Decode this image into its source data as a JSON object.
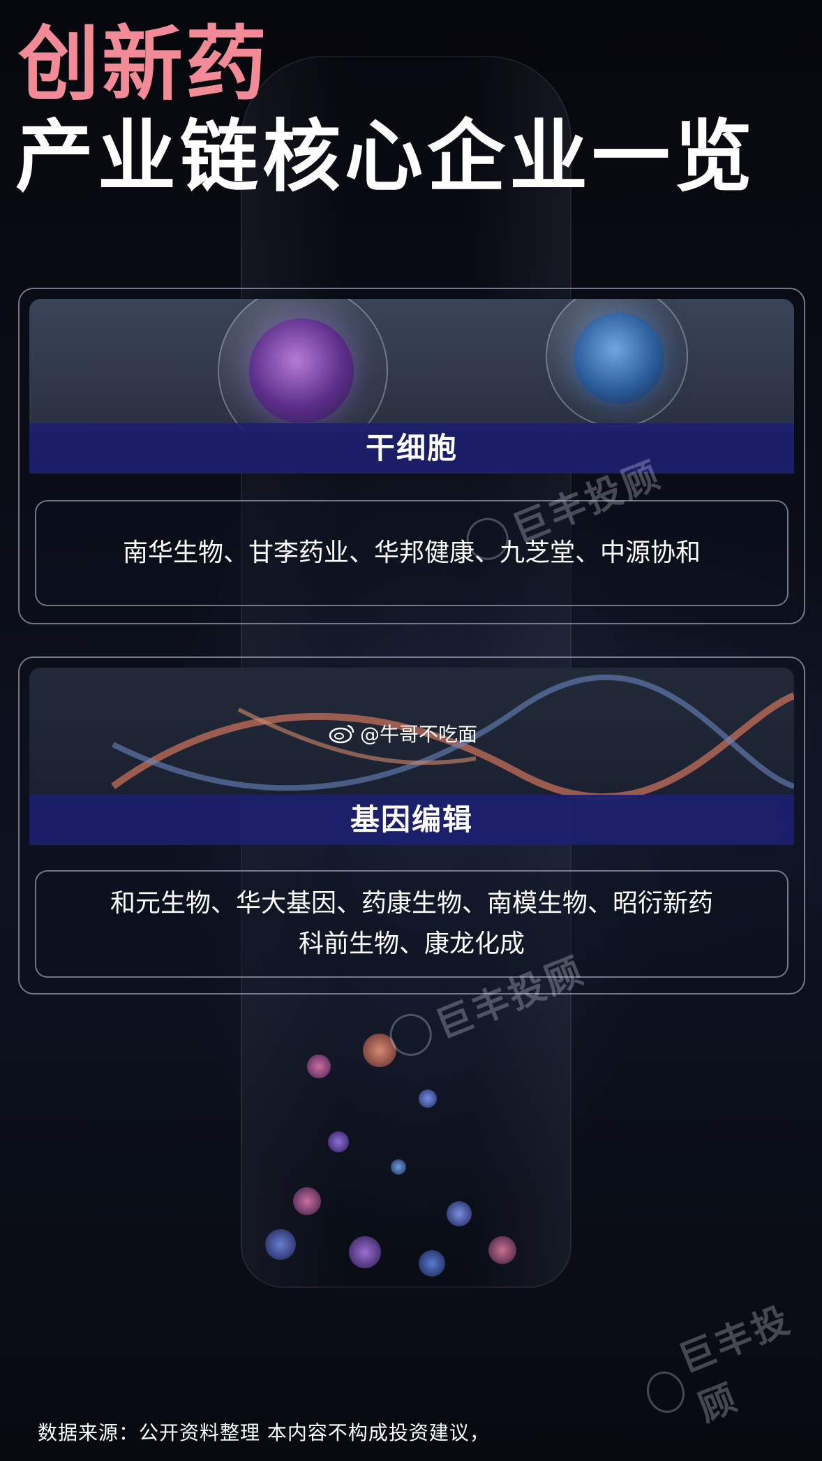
{
  "title": {
    "line1": "创新药",
    "line2": "产业链核心企业一览"
  },
  "sections": [
    {
      "header": "干细胞",
      "items_lines": [
        "南华生物、甘李药业、华邦健康、九芝堂、中源协和"
      ]
    },
    {
      "header": "基因编辑",
      "items_lines": [
        "和元生物、华大基因、药康生物、南模生物、昭衍新药",
        "科前生物、康龙化成"
      ]
    }
  ],
  "weibo_handle": "@牛哥不吃面",
  "watermark_text": "巨丰投顾",
  "footer": "数据来源：公开资料整理  本内容不构成投资建议，",
  "colors": {
    "title_accent": "#f38a98",
    "header_bar": "#1c206e",
    "text": "#ffffff"
  },
  "icons": [
    "weibo-logo-icon",
    "jufeng-logo-icon"
  ]
}
